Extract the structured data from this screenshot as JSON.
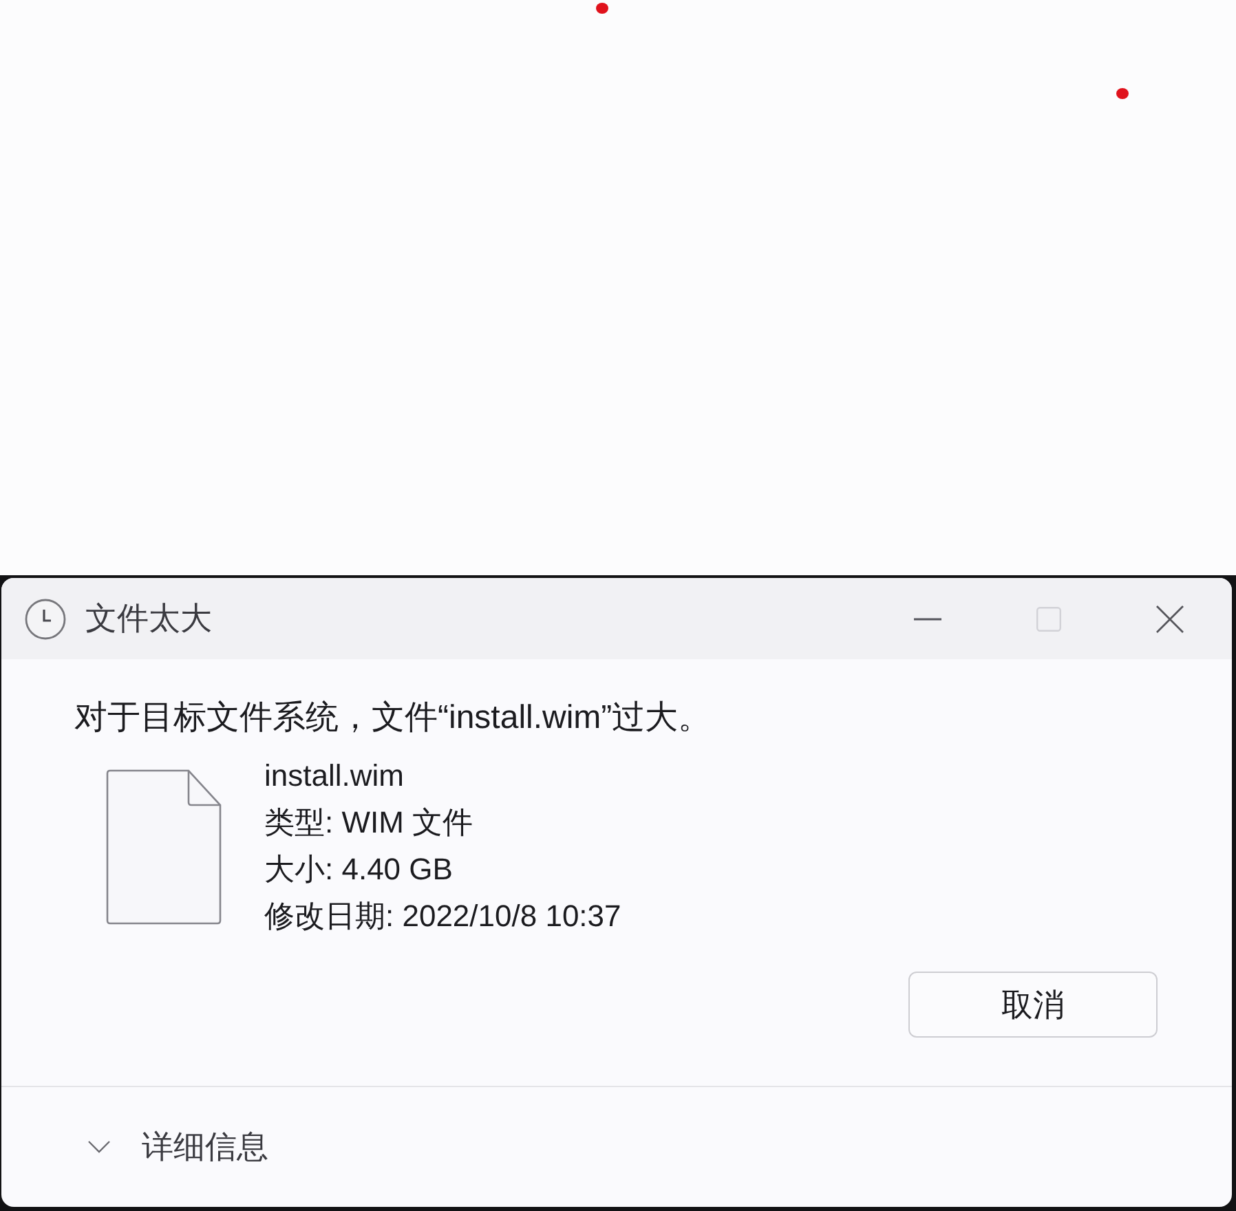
{
  "window": {
    "title": "文件太大",
    "controls": [
      {
        "kind": "minimize",
        "disabled": false
      },
      {
        "kind": "maximize",
        "disabled": true
      },
      {
        "kind": "close",
        "disabled": false
      }
    ]
  },
  "message": "对于目标文件系统，文件“install.wim”过大。",
  "file": {
    "name": "install.wim",
    "details": [
      "类型: WIM 文件",
      "大小: 4.40 GB",
      "修改日期: 2022/10/8 10:37"
    ]
  },
  "buttons": [
    "取消"
  ],
  "details_toggle": {
    "label": "详细信息",
    "expanded": false
  }
}
